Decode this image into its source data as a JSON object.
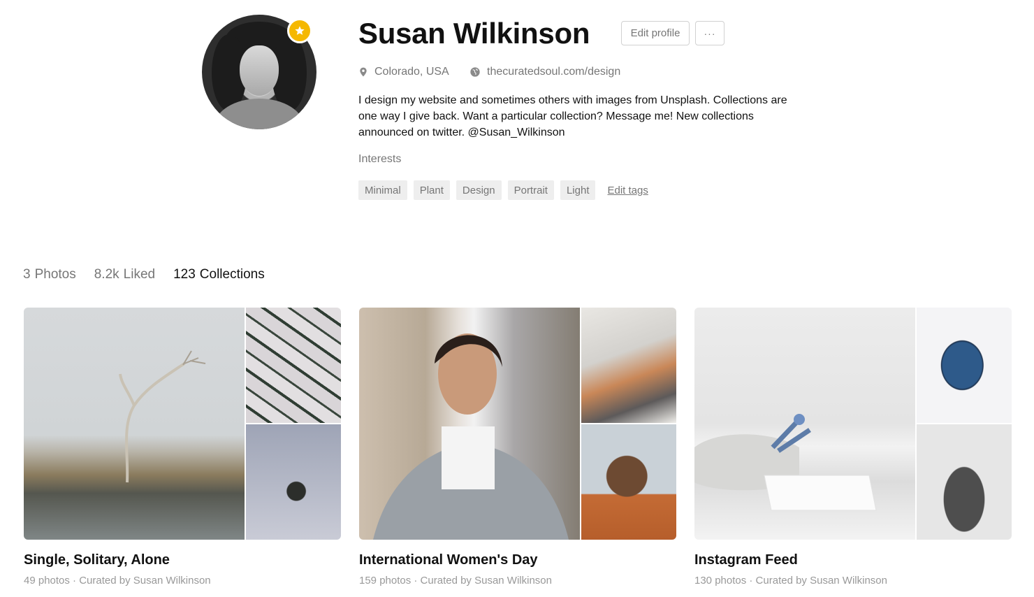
{
  "profile": {
    "name": "Susan Wilkinson",
    "edit_button": "Edit profile",
    "more_button": "···",
    "location": "Colorado, USA",
    "website": "thecuratedsoul.com/design",
    "bio": "I design my website and sometimes others with images from Unsplash. Collections are one way I give back. Want a particular collection? Message me! New collections announced on twitter. @Susan_Wilkinson",
    "interests_label": "Interests",
    "tags": [
      "Minimal",
      "Plant",
      "Design",
      "Portrait",
      "Light"
    ],
    "edit_tags": "Edit tags",
    "badge_color": "#f5b800"
  },
  "tabs": [
    {
      "count": "3",
      "label": "Photos",
      "active": false
    },
    {
      "count": "8.2k",
      "label": "Liked",
      "active": false
    },
    {
      "count": "123",
      "label": "Collections",
      "active": true
    }
  ],
  "collections": [
    {
      "title": "Single, Solitary, Alone",
      "subtitle": "49 photos · Curated by Susan Wilkinson"
    },
    {
      "title": "International Women's Day",
      "subtitle": "159 photos · Curated by Susan Wilkinson"
    },
    {
      "title": "Instagram Feed",
      "subtitle": "130 photos · Curated by Susan Wilkinson"
    }
  ],
  "colors": {
    "text": "#111111",
    "muted": "#767676",
    "tag_bg": "#eeeeee"
  }
}
